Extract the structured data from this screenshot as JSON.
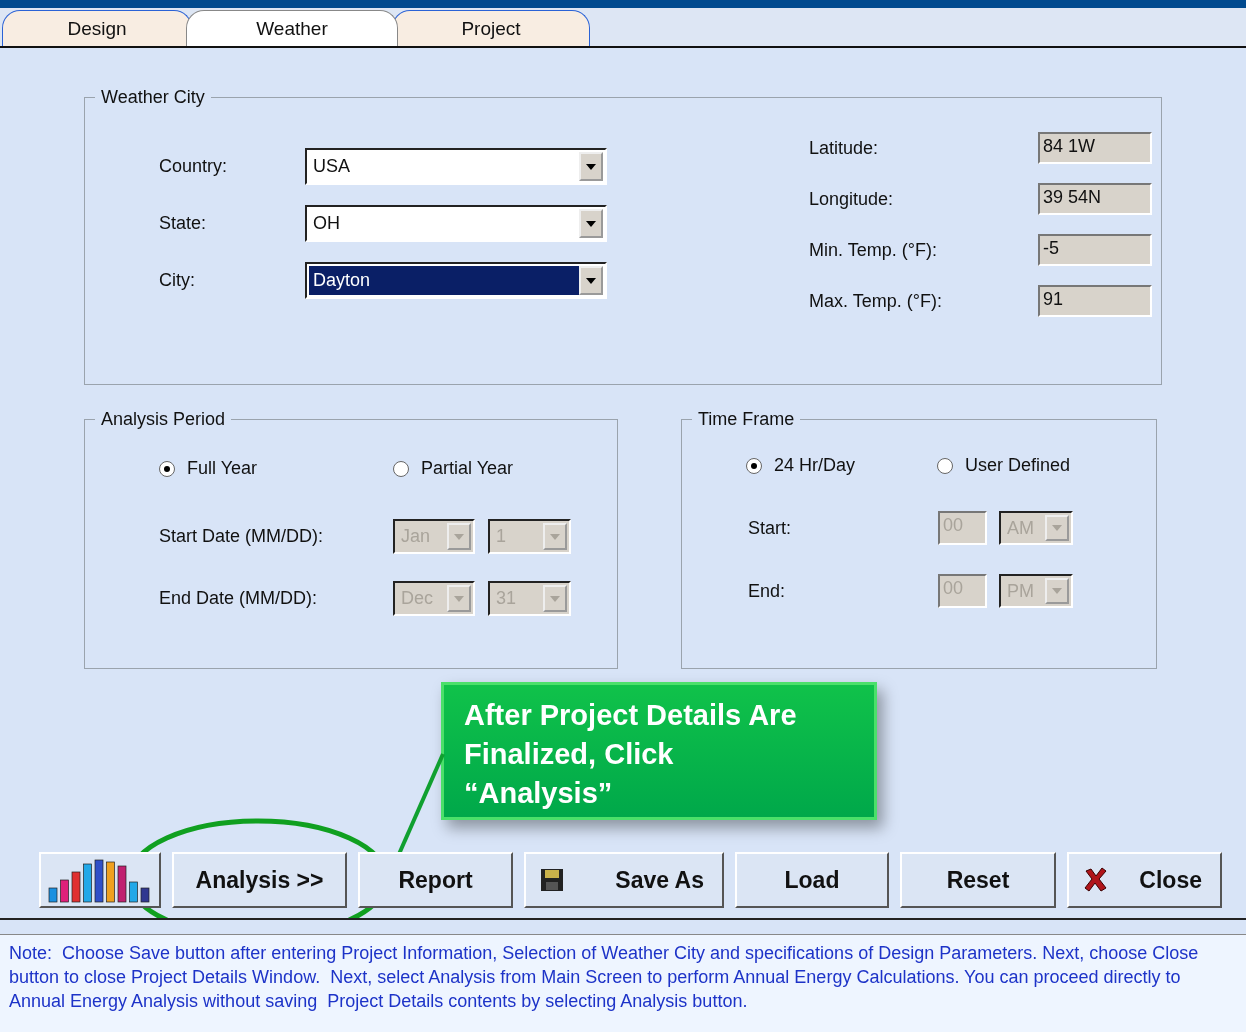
{
  "tabs": [
    {
      "label": "Design",
      "selected": false
    },
    {
      "label": "Weather",
      "selected": true
    },
    {
      "label": "Project",
      "selected": false
    }
  ],
  "weather_city": {
    "title": "Weather City",
    "location": [
      {
        "label": "Country:",
        "value": "USA",
        "selected": false
      },
      {
        "label": "State:",
        "value": "OH",
        "selected": false
      },
      {
        "label": "City:",
        "value": "Dayton",
        "selected": true
      }
    ],
    "readouts": [
      {
        "label": "Latitude:",
        "value": "84 1W"
      },
      {
        "label": "Longitude:",
        "value": "39 54N"
      },
      {
        "label": "Min. Temp. (°F):",
        "value": "-5"
      },
      {
        "label": "Max. Temp. (°F):",
        "value": "91"
      }
    ]
  },
  "analysis_period": {
    "title": "Analysis Period",
    "options": [
      {
        "label": "Full Year",
        "selected": true
      },
      {
        "label": "Partial Year",
        "selected": false
      }
    ],
    "dates": [
      {
        "label": "Start Date (MM/DD):",
        "month": "Jan",
        "day": "1",
        "disabled": true
      },
      {
        "label": "End Date (MM/DD):",
        "month": "Dec",
        "day": "31",
        "disabled": true
      }
    ]
  },
  "time_frame": {
    "title": "Time Frame",
    "options": [
      {
        "label": "24 Hr/Day",
        "selected": true
      },
      {
        "label": "User Defined",
        "selected": false
      }
    ],
    "times": [
      {
        "label": "Start:",
        "hour": "00",
        "period": "AM",
        "disabled": true
      },
      {
        "label": "End:",
        "hour": "00",
        "period": "PM",
        "disabled": true
      }
    ]
  },
  "callout": {
    "text": "After Project Details Are Finalized, Click “Analysis”"
  },
  "buttons": [
    {
      "kind": "chart"
    },
    {
      "kind": "text",
      "label": "Analysis >>"
    },
    {
      "kind": "text",
      "label": "Report"
    },
    {
      "kind": "save",
      "label": "Save As"
    },
    {
      "kind": "text",
      "label": "Load"
    },
    {
      "kind": "text",
      "label": "Reset"
    },
    {
      "kind": "close",
      "label": "Close"
    }
  ],
  "note": {
    "lines": [
      "Note:  Choose Save button after entering Project Information, Selection of Weather City and specifications of Design Parameters. Next, choose Close",
      "button to close Project Details Window.  Next, select Analysis from Main Screen to perform Annual Energy Calculations. You can proceed directly to",
      "Annual Energy Analysis without saving  Project Details contents by selecting Analysis button."
    ]
  }
}
